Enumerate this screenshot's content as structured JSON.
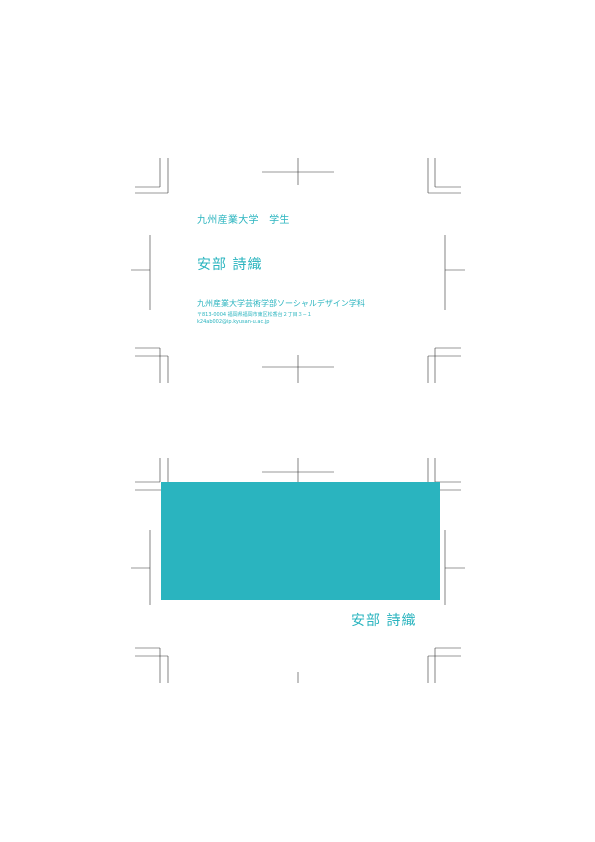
{
  "colors": {
    "accent": "#2ab4bf",
    "crop_marks": "#333333"
  },
  "card_front": {
    "affiliation": "九州産業大学　学生",
    "name": "安部 詩織",
    "department": "九州産業大学芸術学部ソーシャルデザイン学科",
    "address": "〒813-0004 福岡県福岡市東区松香台２丁目３−１",
    "email": "k24ab002@ip.kyusan-u.ac.jp"
  },
  "card_back": {
    "name": "安部 詩織"
  }
}
